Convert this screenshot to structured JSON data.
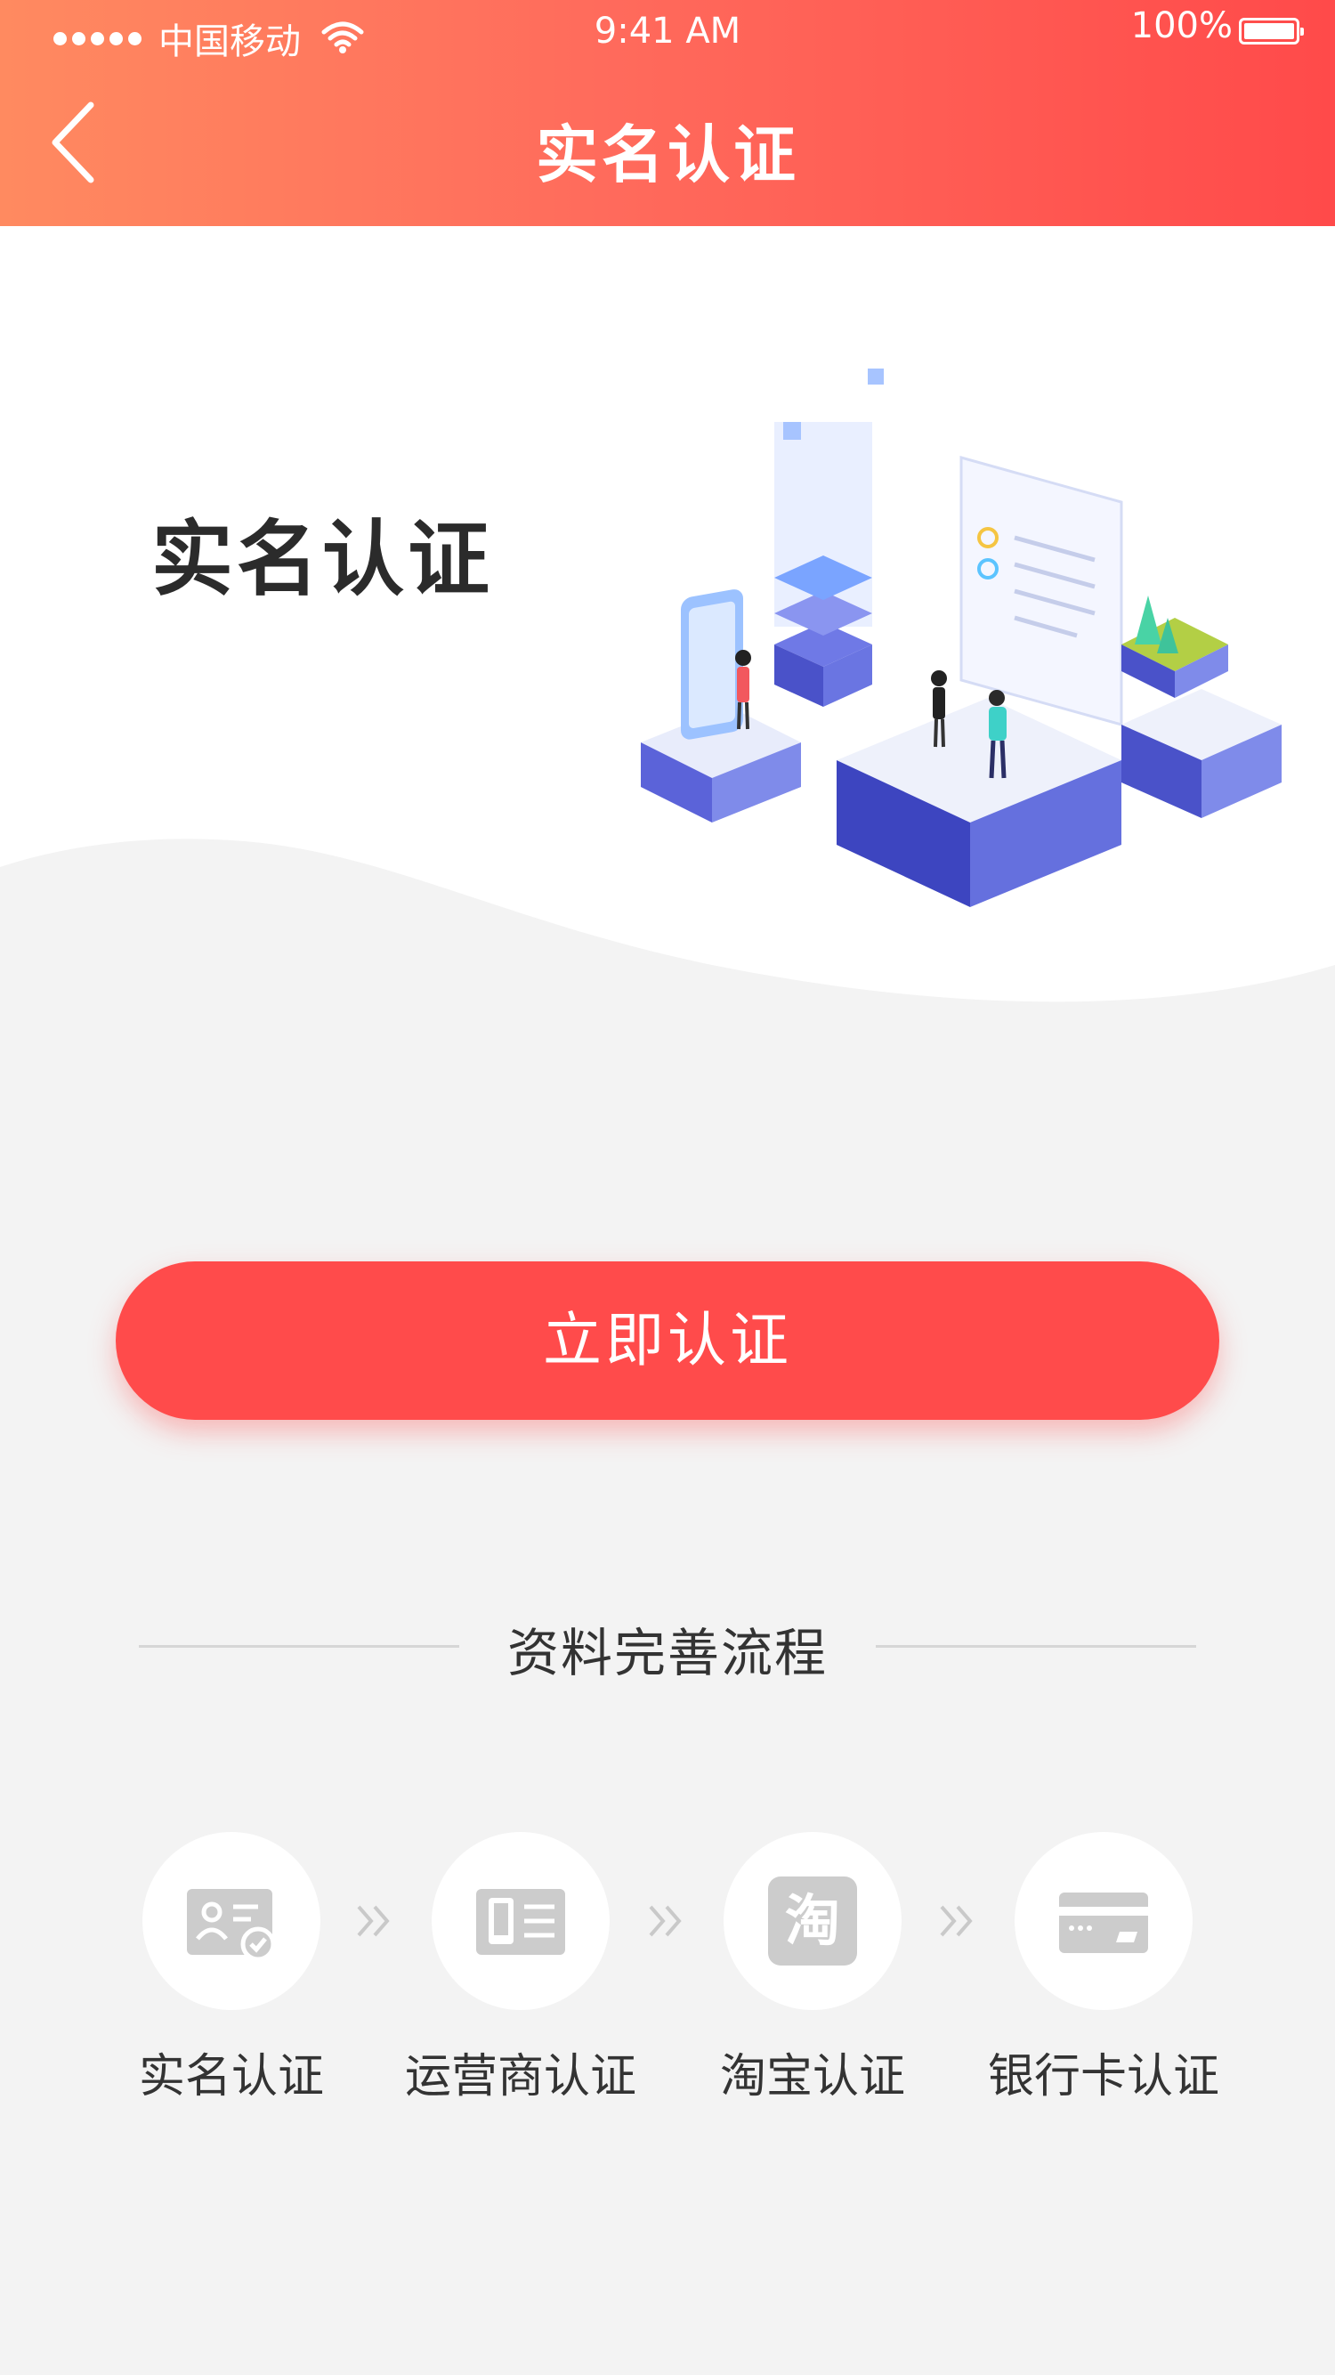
{
  "status_bar": {
    "carrier": "中国移动",
    "time": "9:41 AM",
    "battery": "100%"
  },
  "nav": {
    "title": "实名认证",
    "back_icon": "chevron-left-icon"
  },
  "hero": {
    "title": "实名认证"
  },
  "cta": {
    "label": "立即认证"
  },
  "process": {
    "title": "资料完善流程",
    "steps": [
      {
        "label": "实名认证",
        "icon": "id-card-check-icon"
      },
      {
        "label": "运营商认证",
        "icon": "phone-card-icon"
      },
      {
        "label": "淘宝认证",
        "icon": "taobao-icon",
        "glyph": "淘"
      },
      {
        "label": "银行卡认证",
        "icon": "bank-card-icon"
      }
    ]
  },
  "colors": {
    "header_start": "#ff8a60",
    "header_end": "#ff4a4a",
    "accent": "#ff4b4b",
    "background": "#f3f3f3",
    "step_icon": "#cccccc"
  }
}
